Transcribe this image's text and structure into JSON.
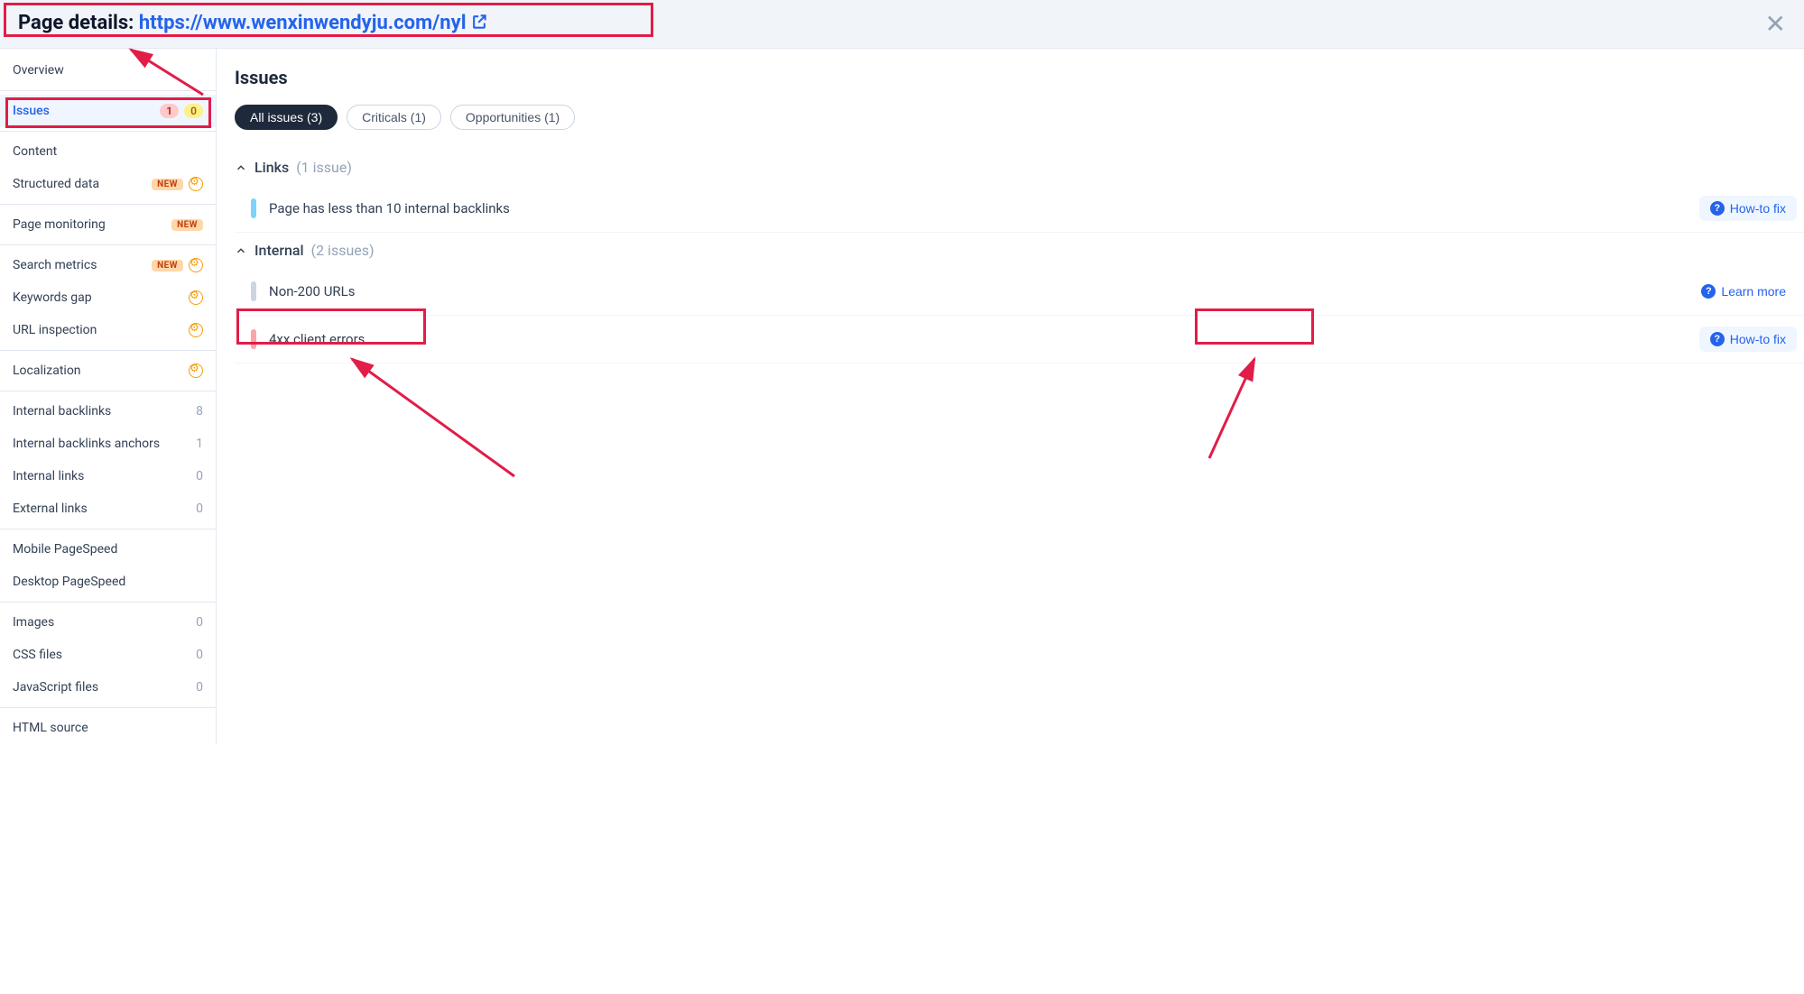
{
  "header": {
    "title_prefix": "Page details: ",
    "url": "https://www.wenxinwendyju.com/nyl"
  },
  "sidebar": {
    "overview": "Overview",
    "issues": {
      "label": "Issues",
      "critical_count": "1",
      "warning_count": "0"
    },
    "content": "Content",
    "structured_data": {
      "label": "Structured data",
      "new": "NEW"
    },
    "page_monitoring": {
      "label": "Page monitoring",
      "new": "NEW"
    },
    "search_metrics": {
      "label": "Search metrics",
      "new": "NEW"
    },
    "keywords_gap": "Keywords gap",
    "url_inspection": "URL inspection",
    "localization": "Localization",
    "internal_backlinks": {
      "label": "Internal backlinks",
      "count": "8"
    },
    "internal_backlinks_anchors": {
      "label": "Internal backlinks anchors",
      "count": "1"
    },
    "internal_links": {
      "label": "Internal links",
      "count": "0"
    },
    "external_links": {
      "label": "External links",
      "count": "0"
    },
    "mobile_pagespeed": "Mobile PageSpeed",
    "desktop_pagespeed": "Desktop PageSpeed",
    "images": {
      "label": "Images",
      "count": "0"
    },
    "css_files": {
      "label": "CSS files",
      "count": "0"
    },
    "javascript_files": {
      "label": "JavaScript files",
      "count": "0"
    },
    "html_source": "HTML source"
  },
  "main": {
    "title": "Issues",
    "tabs": {
      "all": "All issues (3)",
      "criticals": "Criticals (1)",
      "opportunities": "Opportunities (1)"
    },
    "sections": {
      "links": {
        "title": "Links",
        "count": "(1 issue)"
      },
      "internal": {
        "title": "Internal",
        "count": "(2 issues)"
      }
    },
    "issues": {
      "less_backlinks": "Page has less than 10 internal backlinks",
      "non_200": "Non-200 URLs",
      "client_errors": "4xx client errors"
    },
    "buttons": {
      "how_to_fix": "How-to fix",
      "learn_more": "Learn more"
    }
  }
}
